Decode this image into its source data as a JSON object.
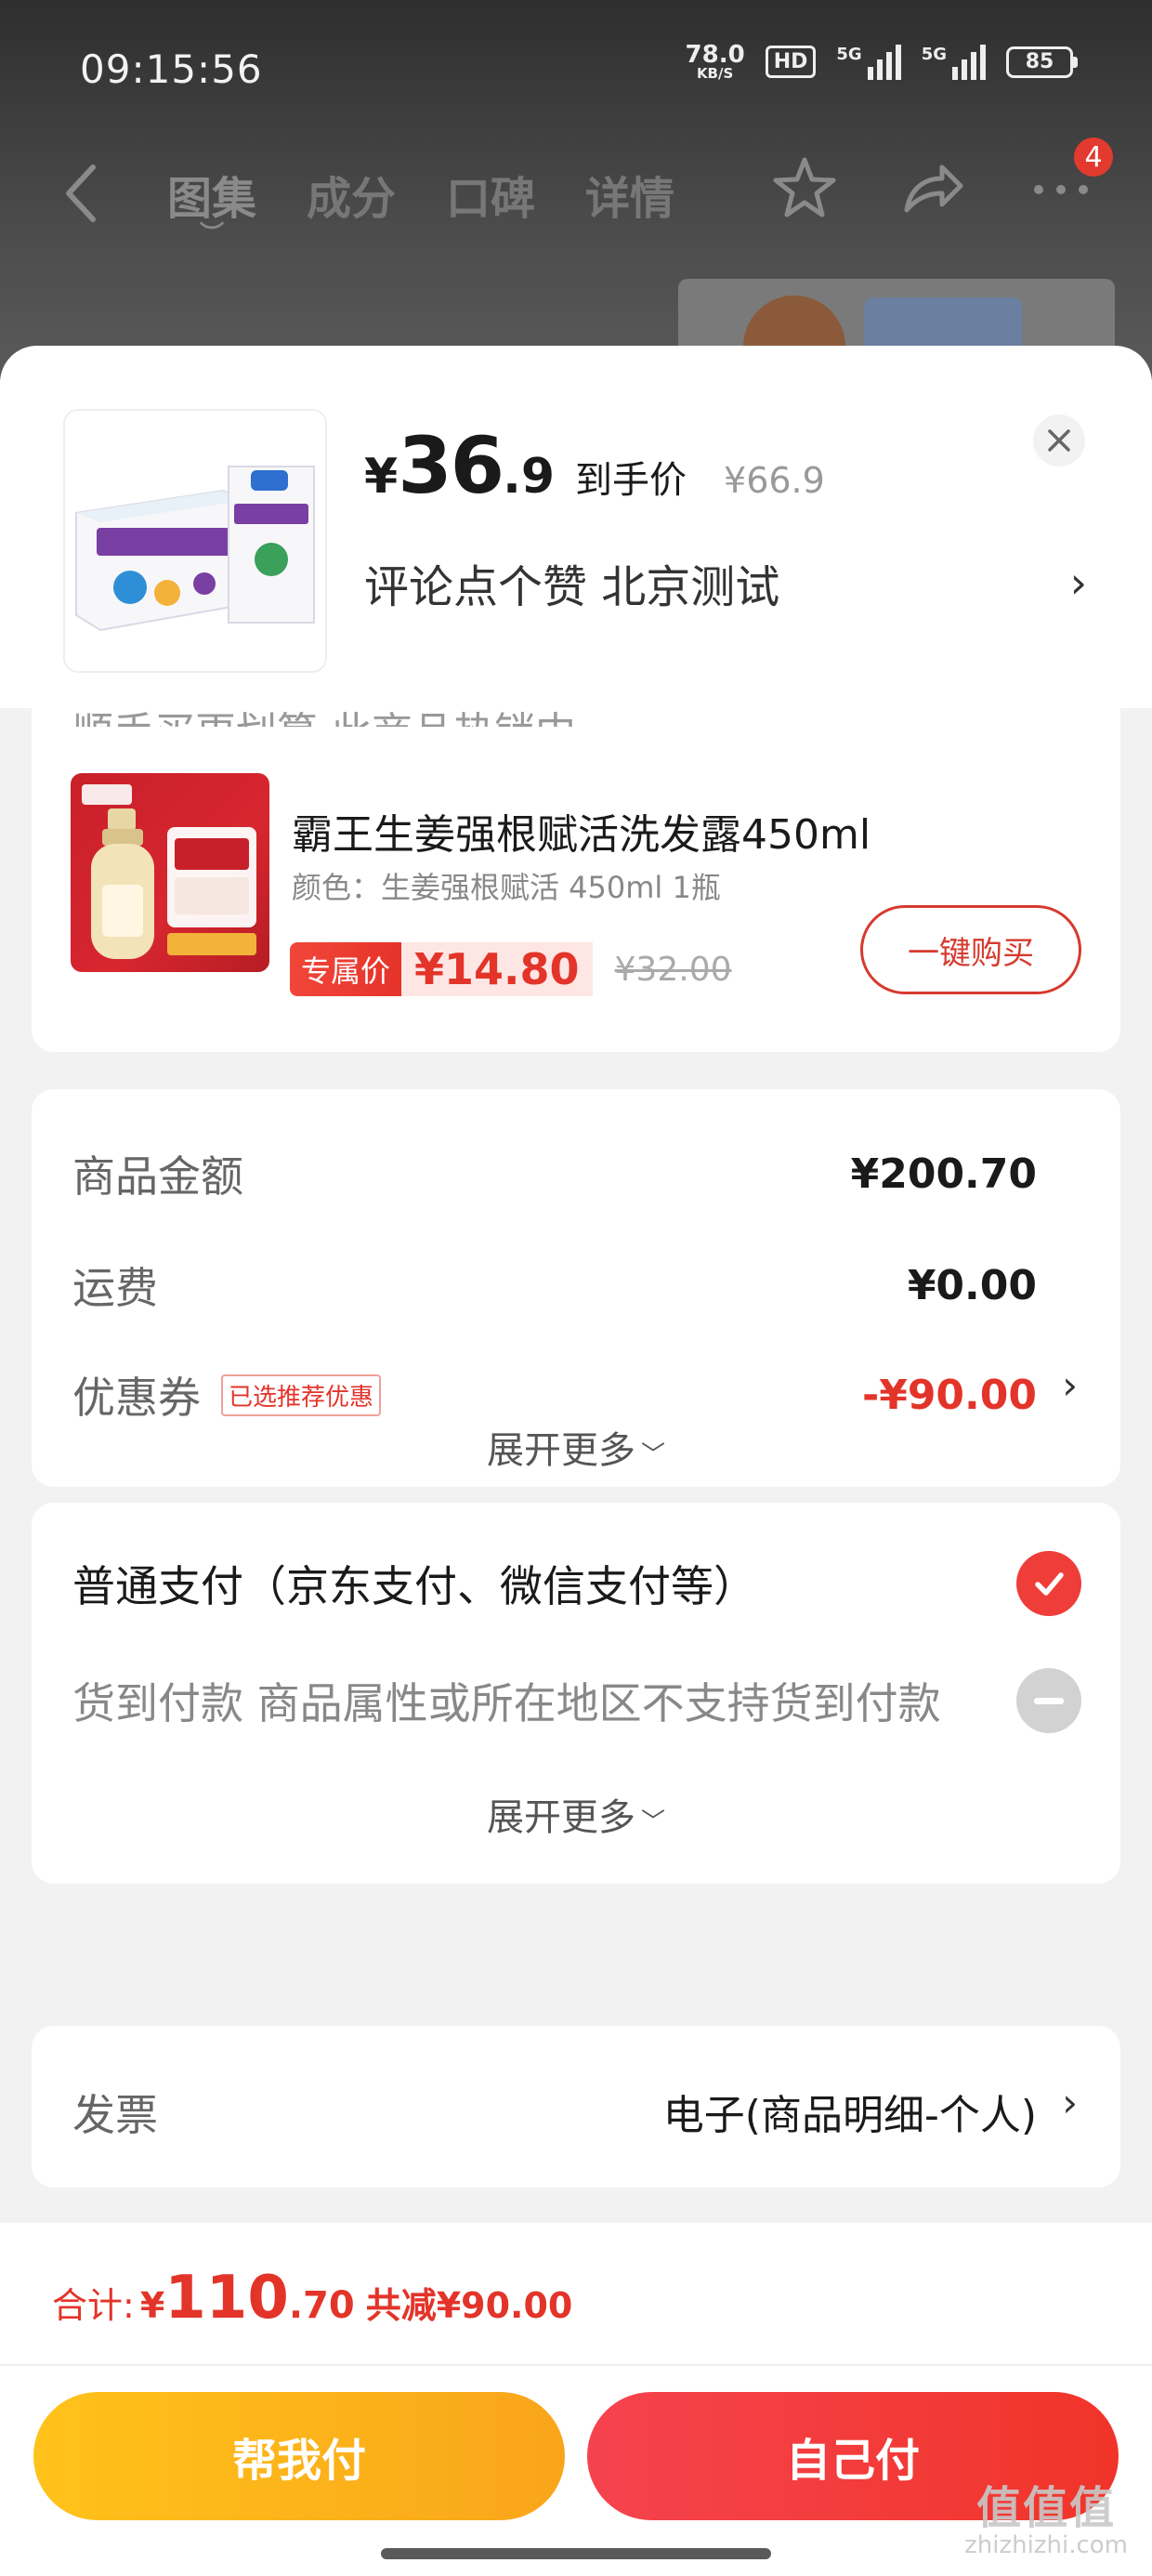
{
  "status_bar": {
    "time": "09:15:56",
    "net_speed": "78.0",
    "net_unit": "KB/S",
    "hd": "HD",
    "signal1": "5G",
    "signal2": "5G",
    "battery": "85"
  },
  "nav": {
    "tabs": [
      {
        "label": "图集"
      },
      {
        "label": "成分"
      },
      {
        "label": "口碑"
      },
      {
        "label": "详情"
      }
    ],
    "message_count": "4"
  },
  "sheet": {
    "price_symbol": "¥",
    "price_int": "36",
    "price_dec": ".9",
    "price_tag": "到手价",
    "price_original": "¥66.9",
    "address": "评论点个赞  北京测试",
    "close_icon": "close-icon"
  },
  "recommend": {
    "partial_heading": "顺手买更划算  此商品热销中",
    "title": "霸王生姜强根赋活洗发露450ml",
    "subtitle": "颜色：生姜强根赋活 450ml 1瓶",
    "tag": "专属价",
    "price": "¥14.80",
    "original_price": "¥32.00",
    "buy_label": "一键购买"
  },
  "amounts": {
    "goods_label": "商品金额",
    "goods_value": "¥200.70",
    "shipping_label": "运费",
    "shipping_value": "¥0.00",
    "coupon_label": "优惠券",
    "coupon_pill": "已选推荐优惠",
    "coupon_value": "-¥90.00",
    "expand_label": "展开更多"
  },
  "payment": {
    "normal_label": "普通支付（京东支付、微信支付等）",
    "cod_label": "货到付款  商品属性或所在地区不支持货到付款",
    "expand_label": "展开更多"
  },
  "invoice": {
    "label": "发票",
    "value": "电子(商品明细-个人)"
  },
  "footer": {
    "total_label": "合计:",
    "total_symbol": "¥",
    "total_int": "110",
    "total_dec": ".70",
    "total_save": "共减¥90.00",
    "help_pay_label": "帮我付",
    "self_pay_label": "自己付"
  },
  "watermark": {
    "big": "值值值",
    "small": "zhizhizhi.com"
  },
  "colors": {
    "accent_red": "#e3342a",
    "check_red": "#ef3d3a",
    "help_yellow": "#f9a51a"
  }
}
